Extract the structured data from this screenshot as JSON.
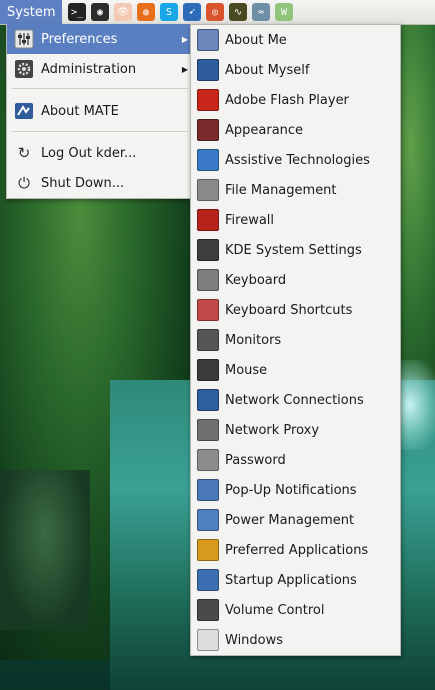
{
  "panel": {
    "system_label": "System",
    "launchers": [
      {
        "icon": "terminal-icon",
        "glyph": ">_",
        "color": "#222222"
      },
      {
        "icon": "camera-lens-icon",
        "glyph": "◉",
        "color": "#2b2b2b"
      },
      {
        "icon": "eye-icon",
        "glyph": "👁",
        "color": "#f4c9b3"
      },
      {
        "icon": "firefox-icon",
        "glyph": "◍",
        "color": "#e76f1c"
      },
      {
        "icon": "skype-icon",
        "glyph": "S",
        "color": "#1ba7e6"
      },
      {
        "icon": "compass-icon",
        "glyph": "➹",
        "color": "#2c6bb8"
      },
      {
        "icon": "disc-icon",
        "glyph": "◎",
        "color": "#d9532c"
      },
      {
        "icon": "system-monitor-icon",
        "glyph": "∿",
        "color": "#4a4a22"
      },
      {
        "icon": "shark-icon",
        "glyph": "≈",
        "color": "#6f8fa8"
      },
      {
        "icon": "w-logo-icon",
        "glyph": "W",
        "color": "#8fc47a"
      }
    ]
  },
  "main_menu": {
    "items": [
      {
        "label": "Preferences",
        "icon": "preferences-sliders-icon",
        "submenu": true,
        "active": true
      },
      {
        "label": "Administration",
        "icon": "administration-gear-icon",
        "submenu": true,
        "active": false
      },
      {
        "label": "About MATE",
        "icon": "mate-logo-icon",
        "submenu": false,
        "active": false
      },
      {
        "label": "Log Out kder...",
        "icon": "logout-icon",
        "submenu": false,
        "active": false
      },
      {
        "label": "Shut Down...",
        "icon": "power-icon",
        "submenu": false,
        "active": false
      }
    ]
  },
  "submenu": {
    "items": [
      {
        "label": "About Me",
        "icon": "id-card-icon",
        "color": "#6b86b8"
      },
      {
        "label": "About Myself",
        "icon": "person-icon",
        "color": "#2f5c9c"
      },
      {
        "label": "Adobe Flash Player",
        "icon": "flash-icon",
        "color": "#c8261c"
      },
      {
        "label": "Appearance",
        "icon": "tie-icon",
        "color": "#7a2a2a"
      },
      {
        "label": "Assistive Technologies",
        "icon": "accessibility-icon",
        "color": "#3a78c8"
      },
      {
        "label": "File Management",
        "icon": "file-cabinet-icon",
        "color": "#8a8a8a"
      },
      {
        "label": "Firewall",
        "icon": "firewall-icon",
        "color": "#b8241c"
      },
      {
        "label": "KDE System Settings",
        "icon": "kde-settings-icon",
        "color": "#3d3d3d"
      },
      {
        "label": "Keyboard",
        "icon": "keyboard-icon",
        "color": "#7d7d7d"
      },
      {
        "label": "Keyboard Shortcuts",
        "icon": "keyboard-shortcuts-icon",
        "color": "#c04a4a"
      },
      {
        "label": "Monitors",
        "icon": "monitor-icon",
        "color": "#555555"
      },
      {
        "label": "Mouse",
        "icon": "mouse-icon",
        "color": "#3b3b3b"
      },
      {
        "label": "Network Connections",
        "icon": "network-icon",
        "color": "#2e5f9e"
      },
      {
        "label": "Network Proxy",
        "icon": "proxy-icon",
        "color": "#6f6f6f"
      },
      {
        "label": "Password",
        "icon": "keypad-icon",
        "color": "#8c8c8c"
      },
      {
        "label": "Pop-Up Notifications",
        "icon": "notification-icon",
        "color": "#4a78b8"
      },
      {
        "label": "Power Management",
        "icon": "power-management-icon",
        "color": "#4e7fc0"
      },
      {
        "label": "Preferred Applications",
        "icon": "star-icon",
        "color": "#d99a20"
      },
      {
        "label": "Startup Applications",
        "icon": "startup-icon",
        "color": "#3b6fb2"
      },
      {
        "label": "Volume Control",
        "icon": "speaker-icon",
        "color": "#4a4a4a"
      },
      {
        "label": "Windows",
        "icon": "window-icon",
        "color": "#dcdcdc"
      }
    ]
  }
}
